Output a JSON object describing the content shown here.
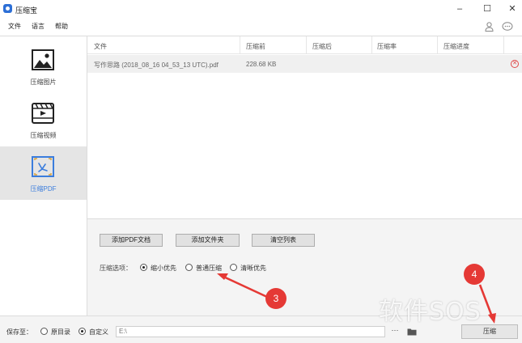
{
  "window": {
    "title": "压缩宝",
    "minimize": "–",
    "maximize": "☐",
    "close": "✕"
  },
  "menu": {
    "items": [
      "文件",
      "语言",
      "帮助"
    ]
  },
  "sidebar": {
    "items": [
      {
        "label": "压缩图片",
        "icon": "image-icon",
        "active": false
      },
      {
        "label": "压缩视频",
        "icon": "video-icon",
        "active": false
      },
      {
        "label": "压缩PDF",
        "icon": "pdf-icon",
        "active": true
      }
    ]
  },
  "table": {
    "headers": [
      "文件",
      "压缩前",
      "压缩后",
      "压缩率",
      "压缩进度"
    ],
    "rows": [
      {
        "file": "写作思路 (2018_08_16 04_53_13 UTC).pdf",
        "before": "228.68 KB",
        "after": "",
        "rate": "",
        "progress": ""
      }
    ]
  },
  "actions": {
    "add_pdf": "添加PDF文档",
    "add_folder": "添加文件夹",
    "clear_list": "清空列表"
  },
  "compress_options": {
    "label": "压缩选项：",
    "options": [
      "缩小优先",
      "普通压缩",
      "清晰优先"
    ],
    "selected": "缩小优先"
  },
  "save": {
    "label": "保存至：",
    "options": [
      "原目录",
      "自定义"
    ],
    "selected": "自定义",
    "path": "E:\\",
    "browse": "···",
    "compress_button": "压缩"
  },
  "annotations": [
    "3",
    "4"
  ],
  "watermark": "软件SOS",
  "colors": {
    "accent": "#3b7ddd",
    "annotation": "#e53935",
    "delete": "#e04848"
  }
}
